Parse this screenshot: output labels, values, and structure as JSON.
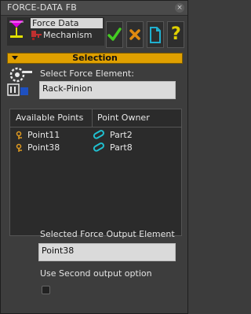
{
  "window": {
    "title": "FORCE-DATA FB",
    "close_glyph": "×"
  },
  "tree": {
    "items": [
      {
        "label": "Force Data",
        "selected": true
      },
      {
        "label": "Mechanism"
      }
    ]
  },
  "toolbar": {
    "accept": "check-icon",
    "cancel": "x-icon",
    "new": "document-icon",
    "help_label": "?"
  },
  "section": {
    "label": "Selection"
  },
  "select_force": {
    "label": "Select Force Element:",
    "value": "Rack-Pinion"
  },
  "points_table": {
    "headers": [
      "Available Points",
      "Point Owner"
    ],
    "rows": [
      {
        "point": "Point11",
        "owner": "Part2"
      },
      {
        "point": "Point38",
        "owner": "Part8"
      }
    ]
  },
  "output": {
    "label": "Selected Force Output Element",
    "value": "Point38",
    "second_label": "Use Second output option",
    "second_checked": false
  },
  "colors": {
    "accent": "#e0a000",
    "check": "#44cc22",
    "cross": "#e08a10",
    "help": "#e0d000",
    "doc": "#20b0d0"
  }
}
